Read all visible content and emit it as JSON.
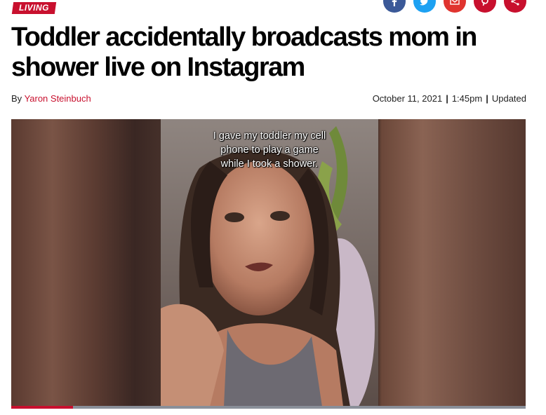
{
  "section": {
    "label": "LIVING"
  },
  "share": [
    {
      "icon": "facebook-icon",
      "color": "#3b5998"
    },
    {
      "icon": "twitter-icon",
      "color": "#1da1f2"
    },
    {
      "icon": "email-icon",
      "color": "#e0342f"
    },
    {
      "icon": "pinterest-icon",
      "color": "#c8102e"
    },
    {
      "icon": "share-icon",
      "color": "#c8102e"
    }
  ],
  "article": {
    "headline": "Toddler accidentally broadcasts mom in shower live on Instagram",
    "byline_prefix": "By",
    "author": "Yaron Steinbuch",
    "date": "October 11, 2021",
    "time": "1:45pm",
    "updated_label": "Updated"
  },
  "video": {
    "caption": [
      "I gave my toddler my cell",
      "phone to play a game",
      "while I took a shower."
    ],
    "progress": 0.12
  },
  "colors": {
    "accent": "#c8102e"
  }
}
